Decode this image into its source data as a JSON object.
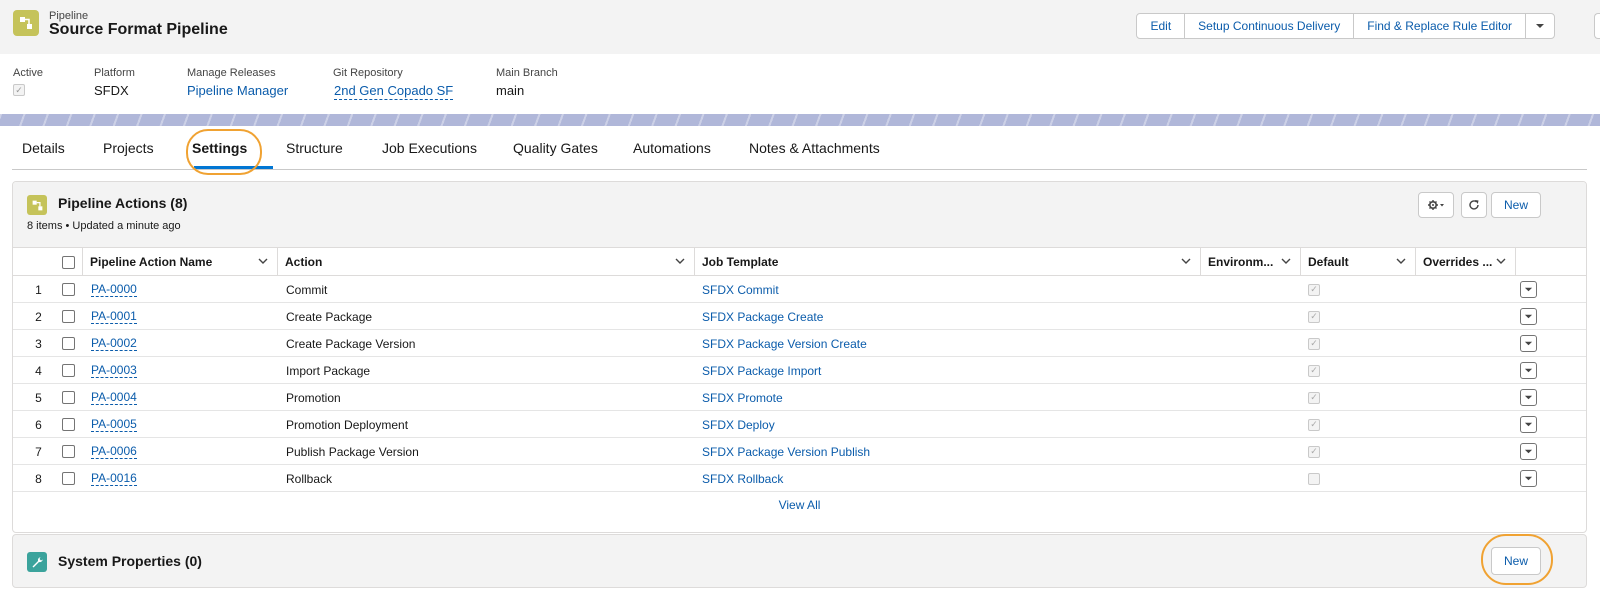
{
  "header": {
    "object_type": "Pipeline",
    "title": "Source Format Pipeline",
    "actions": [
      "Edit",
      "Setup Continuous Delivery",
      "Find & Replace Rule Editor"
    ]
  },
  "highlights": {
    "active_label": "Active",
    "platform_label": "Platform",
    "platform_value": "SFDX",
    "releases_label": "Manage Releases",
    "releases_value": "Pipeline Manager",
    "git_label": "Git Repository",
    "git_value": "2nd Gen Copado SF",
    "branch_label": "Main Branch",
    "branch_value": "main"
  },
  "tabs": [
    "Details",
    "Projects",
    "Settings",
    "Structure",
    "Job Executions",
    "Quality Gates",
    "Automations",
    "Notes & Attachments"
  ],
  "active_tab": "Settings",
  "actions_card": {
    "title": "Pipeline Actions (8)",
    "subtitle": "8 items • Updated a minute ago",
    "new_label": "New",
    "view_all": "View All",
    "columns": [
      "Pipeline Action Name",
      "Action",
      "Job Template",
      "Environm...",
      "Default",
      "Overrides ..."
    ],
    "rows": [
      {
        "num": "1",
        "name": "PA-0000",
        "action": "Commit",
        "template": "SFDX Commit",
        "default": true
      },
      {
        "num": "2",
        "name": "PA-0001",
        "action": "Create Package",
        "template": "SFDX Package Create",
        "default": true
      },
      {
        "num": "3",
        "name": "PA-0002",
        "action": "Create Package Version",
        "template": "SFDX Package Version Create",
        "default": true
      },
      {
        "num": "4",
        "name": "PA-0003",
        "action": "Import Package",
        "template": "SFDX Package Import",
        "default": true
      },
      {
        "num": "5",
        "name": "PA-0004",
        "action": "Promotion",
        "template": "SFDX Promote",
        "default": true
      },
      {
        "num": "6",
        "name": "PA-0005",
        "action": "Promotion Deployment",
        "template": "SFDX Deploy",
        "default": true
      },
      {
        "num": "7",
        "name": "PA-0006",
        "action": "Publish Package Version",
        "template": "SFDX Package Version Publish",
        "default": true
      },
      {
        "num": "8",
        "name": "PA-0016",
        "action": "Rollback",
        "template": "SFDX Rollback",
        "default": false
      }
    ]
  },
  "system_card": {
    "title": "System Properties (0)",
    "new_label": "New"
  },
  "colors": {
    "link": "#0b5cab",
    "pipeline_icon": "#c5c35a",
    "system_icon": "#3ba39c",
    "highlight_ring": "#f0a232",
    "active_tab_underline": "#0176d3"
  }
}
